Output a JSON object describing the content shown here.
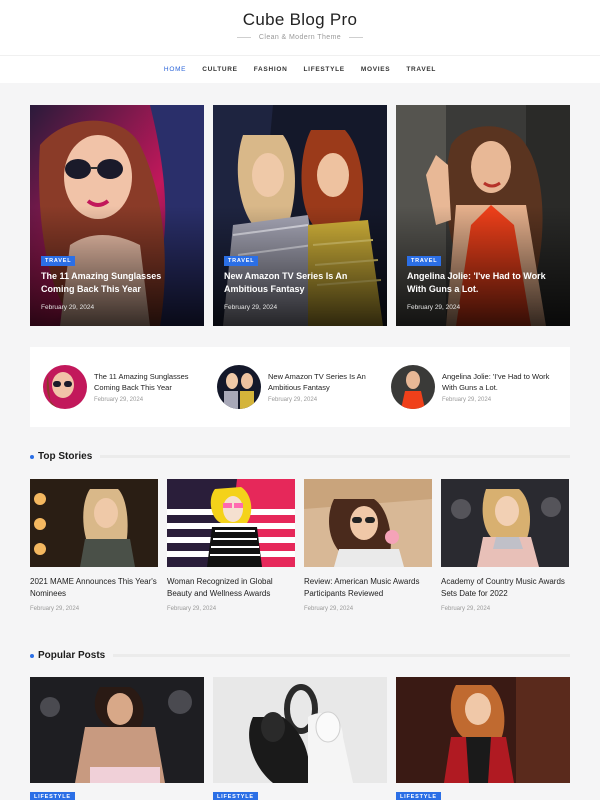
{
  "site": {
    "title": "Cube Blog Pro",
    "tagline": "Clean & Modern Theme"
  },
  "nav": [
    {
      "label": "HOME",
      "active": true
    },
    {
      "label": "CULTURE"
    },
    {
      "label": "FASHION"
    },
    {
      "label": "LIFESTYLE"
    },
    {
      "label": "MOVIES"
    },
    {
      "label": "TRAVEL"
    }
  ],
  "hero": [
    {
      "badge": "TRAVEL",
      "title": "The 11 Amazing Sunglasses Coming Back This Year",
      "date": "February 29, 2024"
    },
    {
      "badge": "TRAVEL",
      "title": "New Amazon TV Series Is An Ambitious Fantasy",
      "date": "February 29, 2024"
    },
    {
      "badge": "TRAVEL",
      "title": "Angelina Jolie: 'I've Had to Work With Guns a Lot.",
      "date": "February 29, 2024"
    }
  ],
  "strip": [
    {
      "title": "The 11 Amazing Sunglasses Coming Back This Year",
      "date": "February 29, 2024"
    },
    {
      "title": "New Amazon TV Series Is An Ambitious Fantasy",
      "date": "February 29, 2024"
    },
    {
      "title": "Angelina Jolie: 'I've Had to Work With Guns a Lot.",
      "date": "February 29, 2024"
    }
  ],
  "top_stories": {
    "heading": "Top Stories",
    "items": [
      {
        "title": "2021 MAME Announces This Year's Nominees",
        "date": "February 29, 2024"
      },
      {
        "title": "Woman Recognized in Global Beauty and Wellness Awards",
        "date": "February 29, 2024"
      },
      {
        "title": "Review: American Music Awards Participants Reviewed",
        "date": "February 29, 2024"
      },
      {
        "title": "Academy of Country Music Awards Sets Date for 2022",
        "date": "February 29, 2024"
      }
    ]
  },
  "popular_posts": {
    "heading": "Popular Posts",
    "items": [
      {
        "badge": "LIFESTYLE"
      },
      {
        "badge": "LIFESTYLE"
      },
      {
        "badge": "LIFESTYLE"
      }
    ]
  },
  "colors": {
    "accent": "#2b6fe6",
    "nav_active": "#2b65d9",
    "background": "#f5f5f6"
  }
}
